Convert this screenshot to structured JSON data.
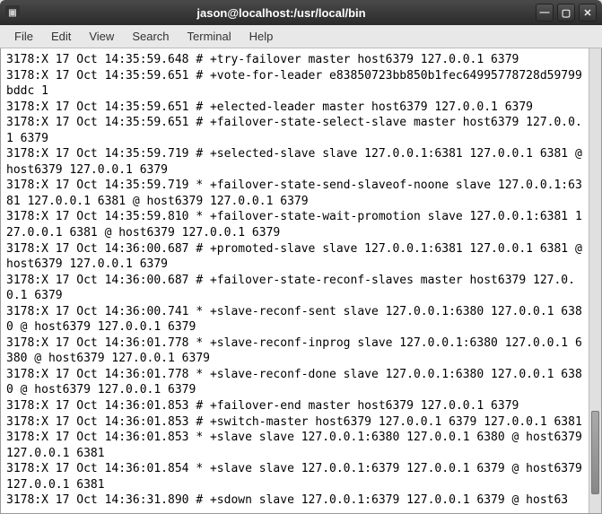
{
  "window": {
    "title": "jason@localhost:/usr/local/bin"
  },
  "menu": {
    "file": "File",
    "edit": "Edit",
    "view": "View",
    "search": "Search",
    "terminal": "Terminal",
    "help": "Help"
  },
  "terminal_lines": [
    "3178:X 17 Oct 14:35:59.648 # +try-failover master host6379 127.0.0.1 6379",
    "3178:X 17 Oct 14:35:59.651 # +vote-for-leader e83850723bb850b1fec64995778728d59799bddc 1",
    "3178:X 17 Oct 14:35:59.651 # +elected-leader master host6379 127.0.0.1 6379",
    "3178:X 17 Oct 14:35:59.651 # +failover-state-select-slave master host6379 127.0.0.1 6379",
    "3178:X 17 Oct 14:35:59.719 # +selected-slave slave 127.0.0.1:6381 127.0.0.1 6381 @ host6379 127.0.0.1 6379",
    "3178:X 17 Oct 14:35:59.719 * +failover-state-send-slaveof-noone slave 127.0.0.1:6381 127.0.0.1 6381 @ host6379 127.0.0.1 6379",
    "3178:X 17 Oct 14:35:59.810 * +failover-state-wait-promotion slave 127.0.0.1:6381 127.0.0.1 6381 @ host6379 127.0.0.1 6379",
    "3178:X 17 Oct 14:36:00.687 # +promoted-slave slave 127.0.0.1:6381 127.0.0.1 6381 @ host6379 127.0.0.1 6379",
    "3178:X 17 Oct 14:36:00.687 # +failover-state-reconf-slaves master host6379 127.0.0.1 6379",
    "3178:X 17 Oct 14:36:00.741 * +slave-reconf-sent slave 127.0.0.1:6380 127.0.0.1 6380 @ host6379 127.0.0.1 6379",
    "3178:X 17 Oct 14:36:01.778 * +slave-reconf-inprog slave 127.0.0.1:6380 127.0.0.1 6380 @ host6379 127.0.0.1 6379",
    "3178:X 17 Oct 14:36:01.778 * +slave-reconf-done slave 127.0.0.1:6380 127.0.0.1 6380 @ host6379 127.0.0.1 6379",
    "3178:X 17 Oct 14:36:01.853 # +failover-end master host6379 127.0.0.1 6379",
    "3178:X 17 Oct 14:36:01.853 # +switch-master host6379 127.0.0.1 6379 127.0.0.1 6381",
    "3178:X 17 Oct 14:36:01.853 * +slave slave 127.0.0.1:6380 127.0.0.1 6380 @ host6379 127.0.0.1 6381",
    "3178:X 17 Oct 14:36:01.854 * +slave slave 127.0.0.1:6379 127.0.0.1 6379 @ host6379 127.0.0.1 6381",
    "3178:X 17 Oct 14:36:31.890 # +sdown slave 127.0.0.1:6379 127.0.0.1 6379 @ host63"
  ]
}
